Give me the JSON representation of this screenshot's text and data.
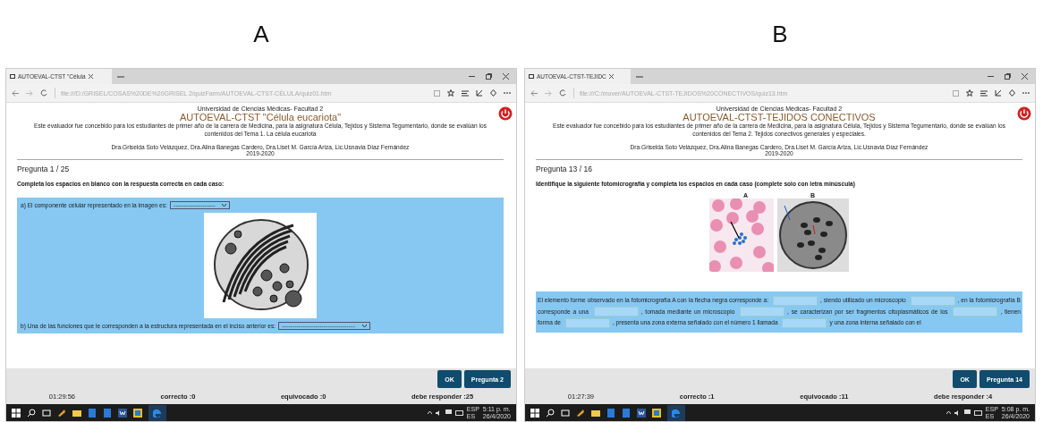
{
  "panels": [
    {
      "label": "A",
      "tab_title": "AUTOEVAL-CTST \"Célula",
      "url": "file:///D:/GRISEL/COSAS%20DE%20GRISEL 2/quizFarm/AUTOEVAL-CTST-CÉLULA/quiz01.htm",
      "university": "Universidad de Ciencias Médicas- Facultad 2",
      "title": "AUTOEVAL-CTST \"Célula eucariota\"",
      "description": "Este evaluador fue concebido para los estudiantes de primer año de la carrera de Medicina, para la asignatura Célula, Tejidos y Sistema Tegumentario, donde se evalúan los contenidos del Tema 1. La célula eucariota",
      "authors": "Dra.Griselda Soto Velázquez, Dra.Alina Banegas Cardero, Dra.Liset M. García Ariza, Lic.Usnavia Díaz Fernández",
      "years": "2019-2020",
      "counter": "Pregunta 1 / 25",
      "instruction": "Completa los espacios en blanco con la respuesta correcta en cada caso:",
      "content": {
        "kind": "select",
        "items": [
          {
            "kind": "question",
            "text": "a) El componente celular representado en la imagen es:",
            "select": "--------------------"
          },
          {
            "kind": "image"
          },
          {
            "kind": "question",
            "text": "b) Una de las funciones que le corresponden a la estructura representada en el inciso anterior es:",
            "select": "-----------------------------------"
          }
        ]
      },
      "ok": "OK",
      "next": "Pregunta 2",
      "timer": "01:29:56",
      "correct": "correcto :0",
      "wrong": "equivocado :0",
      "remaining": "debe responder :25",
      "lang": "ESP",
      "lang2": "ES",
      "time": "5:11 p. m.",
      "date": "26/4/2020"
    },
    {
      "label": "B",
      "tab_title": "AUTOEVAL-CTST-TEJIDC",
      "url": "file:///C:/mover/AUTOEVAL-CTST-TEJIDOS%20CONECTIVOS/quiz13.htm",
      "university": "Universidad de Ciencias Médicas- Facultad 2",
      "title": "AUTOEVAL-CTST-TEJIDOS CONECTIVOS",
      "description": "Este evaluador fue concebido para los estudiantes de primer año de la carrera de Medicina, para la asignatura Célula, Tejidos y Sistema Tegumentario, donde se evalúan los contenidos del Tema 2. Tejidos conectivos generales y especiales.",
      "authors": "Dra.Griselda Soto Velázquez, Dra.Alina Banegas Cardero, Dra.Liset M. García Ariza, Lic.Usnavia Díaz Fernández",
      "years": "2019-2020",
      "counter": "Pregunta 13 / 16",
      "instruction": "Identifique la siguiente fotomicrografía y completa los espacios en cada caso (complete solo con letra minúscula)",
      "content": {
        "kind": "fill",
        "image_labels": [
          "A",
          "B"
        ],
        "passage": [
          {
            "kind": "text",
            "text": "El elemento forme observado en la fotomicrografía A con la flecha negra corresponde a:"
          },
          {
            "kind": "blank"
          },
          {
            "kind": "text",
            "text": ", siendo utilizado un microscopio"
          },
          {
            "kind": "blank"
          },
          {
            "kind": "text",
            "text": ", en la fotomicrografía B corresponde a una"
          },
          {
            "kind": "blank"
          },
          {
            "kind": "text",
            "text": ", tomada mediante un microscopio"
          },
          {
            "kind": "blank"
          },
          {
            "kind": "text",
            "text": ", se caracterizan por ser fragmentos citoplasmáticos de los"
          },
          {
            "kind": "blank"
          },
          {
            "kind": "text",
            "text": ", tienen forma de"
          },
          {
            "kind": "blank"
          },
          {
            "kind": "text",
            "text": ", presenta una zona externa señalado con el número 1 llamada"
          },
          {
            "kind": "blank"
          },
          {
            "kind": "text",
            "text": "y una zona interna señalado con el"
          }
        ]
      },
      "ok": "OK",
      "next": "Pregunta 14",
      "timer": "01:27:39",
      "correct": "correcto :1",
      "wrong": "equivocado :11",
      "remaining": "debe responder :4",
      "lang": "ESP",
      "lang2": "ES",
      "time": "5:08 p. m.",
      "date": "26/4/2020"
    }
  ]
}
